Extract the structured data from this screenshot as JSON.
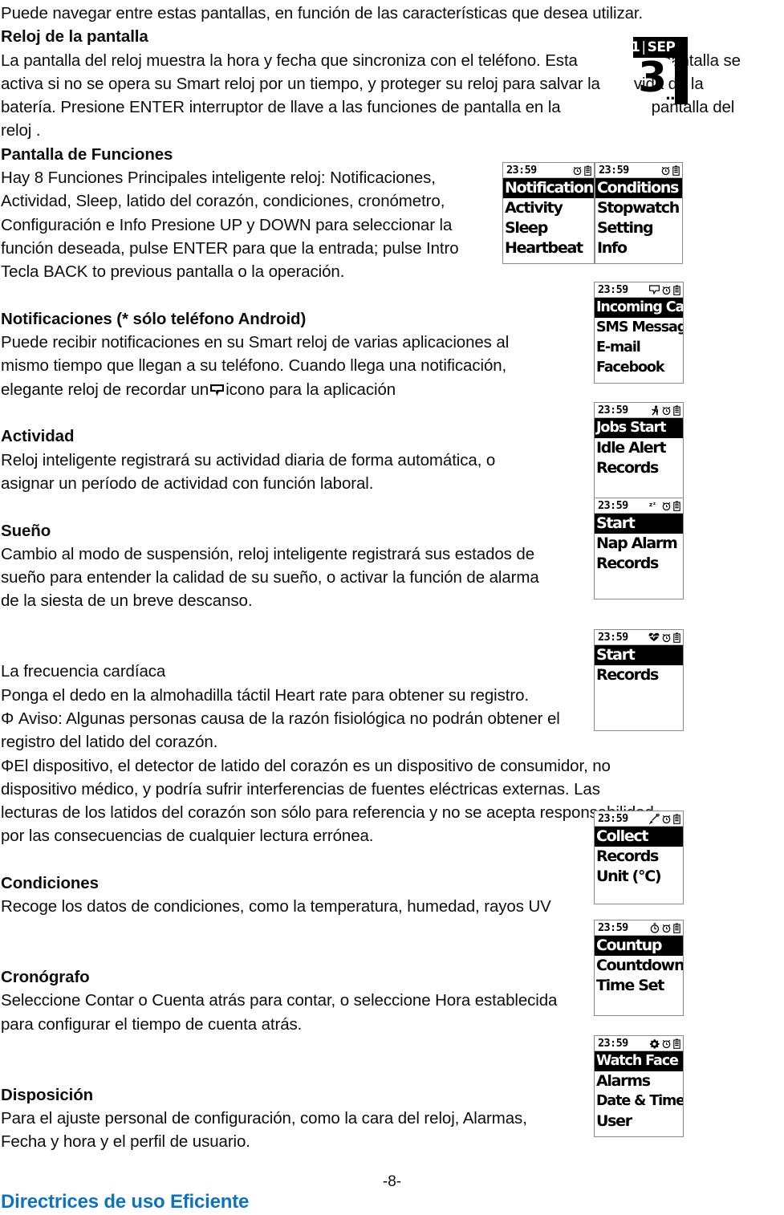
{
  "document": {
    "page_number": "-8-",
    "accent_color": "#1072ba",
    "paragraphs": {
      "intro": "Puede navegar entre estas pantallas, en función de las características que desea utilizar.",
      "h_reloj_pantalla": "Reloj de la pantalla",
      "reloj_l1": "La pantalla del reloj muestra la hora y fecha que sincroniza con el teléfono. Esta",
      "reloj_l1_right": "pantalla se",
      "reloj_l2": "activa si no se opera su Smart reloj por un tiempo, y proteger su reloj para salvar la",
      "reloj_l2_right": "vida de la",
      "reloj_l3": "batería. Presione ENTER interruptor de llave a las funciones de pantalla en la",
      "reloj_l3_right": "pantalla del",
      "reloj_l4": "reloj .",
      "h_pantalla_funciones": "Pantalla de Funciones",
      "funciones_l1": "Hay 8 Funciones Principales inteligente reloj: Notificaciones,",
      "funciones_l2": "Actividad, Sleep, latido del corazón, condiciones, cronómetro,",
      "funciones_l3": "Configuración e Info Presione UP y DOWN para seleccionar la",
      "funciones_l4": "función deseada, pulse ENTER para que la entrada; pulse Intro",
      "funciones_l5": "Tecla BACK to previous pantalla o la operación.",
      "h_notificaciones": "Notificaciones (* sólo teléfono Android)",
      "notif_l1": "Puede recibir notificaciones en su Smart reloj de varias aplicaciones al",
      "notif_l2": "mismo tiempo que llegan a su teléfono. Cuando llega una notificación,",
      "notif_l3a": "elegante reloj de recordar un",
      "notif_l3b": "icono para la aplicación",
      "h_actividad": "Actividad",
      "actividad_l1": "Reloj inteligente registrará su actividad diaria de forma automática, o",
      "actividad_l2": "asignar un período de actividad con función laboral.",
      "h_sueno": "Sueño",
      "sueno_l1": "Cambio al modo de suspensión, reloj inteligente registrará sus estados de",
      "sueno_l2": "sueño para entender la calidad de su sueño, o activar la función de alarma",
      "sueno_l3": "de la siesta de un breve descanso.",
      "h_frecuencia": "La frecuencia cardíaca",
      "frec_l1": "Ponga el dedo en la almohadilla táctil Heart rate para obtener su registro.",
      "frec_l2": "Φ Aviso: Algunas personas causa de la razón fisiológica no podrán obtener el",
      "frec_l3": "registro del latido del corazón.",
      "frec_l4": "ΦEl dispositivo, el detector de latido del corazón es un dispositivo de consumidor, no",
      "frec_l5": "dispositivo médico, y podría sufrir interferencias de fuentes eléctricas externas. Las",
      "frec_l6": "lecturas de los latidos del corazón son sólo para referencia y no se acepta responsabilidad",
      "frec_l7": "por las consecuencias de cualquier lectura errónea.",
      "h_condiciones": "Condiciones",
      "condiciones_l1": "Recoge los datos de condiciones, como la temperatura, humedad, rayos UV",
      "h_cronografo": "Cronógrafo",
      "cronografo_l1": "Seleccione Contar o Cuenta atrás para contar, o seleccione Hora establecida",
      "cronografo_l2": "para configurar el tiempo de cuenta atrás.",
      "h_disposicion": "Disposición",
      "disposicion_l1": "Para el ajuste personal de configuración, como la cara del reloj, Alarmas,",
      "disposicion_l2": "Fecha y hora y el perfil de usuario.",
      "h_directrices": "Directrices de uso Eficiente"
    }
  },
  "watch_face": {
    "day": "1",
    "month": "SEP",
    "big_digit": "3"
  },
  "screens": {
    "main_menu_1": {
      "time": "23:59",
      "icons": [
        "alarm-clock-icon",
        "battery-icon"
      ],
      "items": [
        "Notifications",
        "Activity",
        "Sleep",
        "Heartbeat"
      ],
      "selected_index": 0
    },
    "main_menu_2": {
      "time": "23:59",
      "icons": [
        "alarm-clock-icon",
        "battery-icon"
      ],
      "items": [
        "Conditions",
        "Stopwatch",
        "Setting",
        "Info"
      ],
      "selected_index": 0
    },
    "notifications": {
      "time": "23:59",
      "icons": [
        "message-bubble-icon",
        "alarm-clock-icon",
        "battery-icon"
      ],
      "items": [
        "Incoming Calls",
        "SMS Message",
        "E-mail",
        "Facebook"
      ],
      "selected_index": 0
    },
    "activity": {
      "time": "23:59",
      "icons": [
        "running-person-icon",
        "alarm-clock-icon",
        "battery-icon"
      ],
      "items": [
        "Jobs Start",
        "Idle Alert",
        "Records"
      ],
      "selected_index": 0
    },
    "sleep": {
      "time": "23:59",
      "icons": [
        "sleep-zzz-icon",
        "alarm-clock-icon",
        "battery-icon"
      ],
      "items": [
        "Start",
        "Nap Alarm",
        "Records"
      ],
      "selected_index": 0
    },
    "heartbeat": {
      "time": "23:59",
      "icons": [
        "heart-pulse-icon",
        "alarm-clock-icon",
        "battery-icon"
      ],
      "items": [
        "Start",
        "Records"
      ],
      "selected_index": 0
    },
    "conditions": {
      "time": "23:59",
      "icons": [
        "thermometer-icon",
        "alarm-clock-icon",
        "battery-icon"
      ],
      "items": [
        "Collect",
        "Records",
        "Unit (°C)"
      ],
      "selected_index": 0
    },
    "stopwatch": {
      "time": "23:59",
      "icons": [
        "stopwatch-icon",
        "alarm-clock-icon",
        "battery-icon"
      ],
      "items": [
        "Countup",
        "Countdown",
        "Time Set"
      ],
      "selected_index": 0
    },
    "setting": {
      "time": "23:59",
      "icons": [
        "gear-icon",
        "alarm-clock-icon",
        "battery-icon"
      ],
      "items": [
        "Watch Face",
        "Alarms",
        "Date & Time",
        "User"
      ],
      "selected_index": 0
    }
  }
}
